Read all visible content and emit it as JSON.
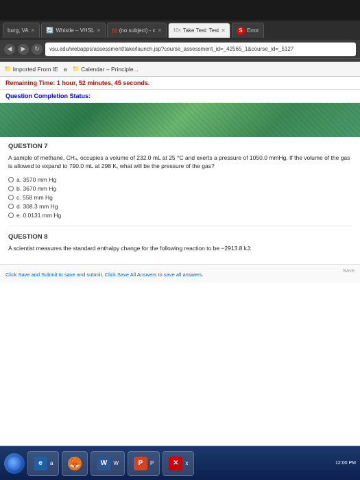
{
  "browser": {
    "tabs": [
      {
        "id": "tab-burg",
        "label": "burg, VA",
        "active": false,
        "favicon": "📄"
      },
      {
        "id": "tab-whistle",
        "label": "Whistle – VHSL",
        "active": false,
        "favicon": "🔄"
      },
      {
        "id": "tab-gmail",
        "label": "(no subject) - c",
        "active": false,
        "favicon": "M"
      },
      {
        "id": "tab-test",
        "label": "Take Test: Test",
        "active": true,
        "favicon": "T"
      },
      {
        "id": "tab-error",
        "label": "Error",
        "active": false,
        "favicon": "!"
      }
    ],
    "address": "vsu.edu/webapps/assessment/take/launch.jsp?course_assessment_id=_42565_1&course_id=_5127",
    "bookmarks": [
      {
        "label": "Imported From IE",
        "type": "folder"
      },
      {
        "label": "a"
      },
      {
        "label": "Calendar – Principle...",
        "type": "folder"
      }
    ]
  },
  "page": {
    "timer_label": "Remaining Time: 1 hour, 52 minutes, 45 seconds.",
    "completion_label": "Question Completion Status:",
    "questions": [
      {
        "number": "QUESTION 7",
        "text": "A sample of methane, CH₄, occupies a volume of 232.0 mL at 25 °C and exerts a pressure of 1050.0 mmHg. If the volume of the gas is allowed to expand to 790.0 mL at 298 K, what will be the pressure of the gas?",
        "options": [
          {
            "label": "a. 3570 mm Hg"
          },
          {
            "label": "b. 3670 mm Hg"
          },
          {
            "label": "c. 558 mm Hg"
          },
          {
            "label": "d. 308.3 mm Hg"
          },
          {
            "label": "e. 0.0131 mm Hg"
          }
        ]
      },
      {
        "number": "QUESTION 8",
        "text": "A scientist measures the standard enthalpy change for the following reaction to be −2913.8 kJ:",
        "options": []
      }
    ],
    "submit_text": "Click Save and Submit to save and submit. Click Save All Answers to save all answers.",
    "save_label": "Save"
  },
  "taskbar": {
    "apps": [
      {
        "icon_type": "ie",
        "icon_label": "e",
        "label": "a"
      },
      {
        "icon_type": "firefox",
        "icon_label": "🦊",
        "label": ""
      },
      {
        "icon_type": "word",
        "icon_label": "W",
        "label": "W"
      },
      {
        "icon_type": "powerpoint",
        "icon_label": "P",
        "label": "P"
      },
      {
        "icon_type": "close-app",
        "icon_label": "✕",
        "label": "x"
      }
    ],
    "time": "12:00 PM"
  }
}
